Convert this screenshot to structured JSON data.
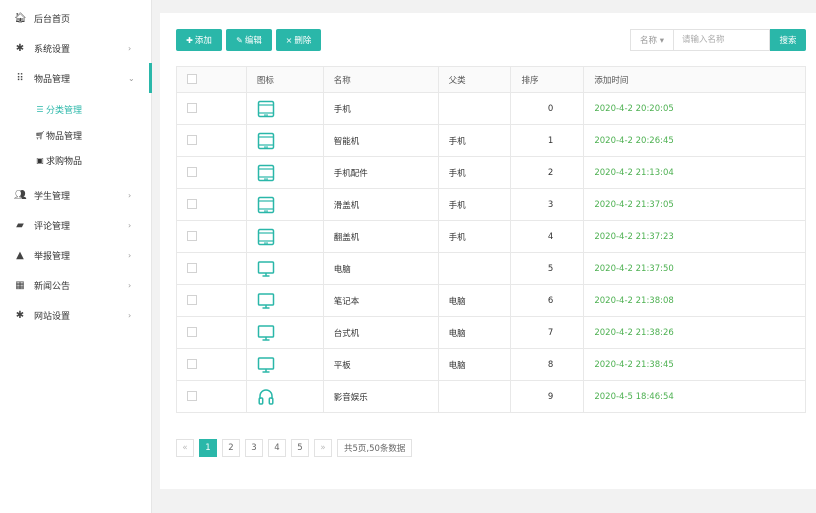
{
  "sidebar": {
    "items": [
      {
        "label": "后台首页",
        "icon": "home-icon",
        "glyph": "🏠︎"
      },
      {
        "label": "系统设置",
        "icon": "gear-icon",
        "glyph": "✱",
        "chevron": "›"
      },
      {
        "label": "物品管理",
        "icon": "grid-dots-icon",
        "glyph": "⠿",
        "chevron": "⌄"
      },
      {
        "label": "学生管理",
        "icon": "users-icon",
        "glyph": "👥︎",
        "chevron": "›"
      },
      {
        "label": "评论管理",
        "icon": "comment-icon",
        "glyph": "▰",
        "chevron": "›"
      },
      {
        "label": "举报管理",
        "icon": "warning-icon",
        "glyph": "▲",
        "chevron": "›"
      },
      {
        "label": "新闻公告",
        "icon": "news-icon",
        "glyph": "▦",
        "chevron": "›"
      },
      {
        "label": "网站设置",
        "icon": "gear-icon",
        "glyph": "✱",
        "chevron": "›"
      }
    ],
    "subitems": [
      {
        "label": "分类管理",
        "icon": "list-icon",
        "glyph": "☰"
      },
      {
        "label": "物品管理",
        "icon": "cart-icon",
        "glyph": "🛒︎"
      },
      {
        "label": "求购物品",
        "icon": "box-icon",
        "glyph": "▣"
      }
    ]
  },
  "toolbar": {
    "add_label": "添加",
    "add_glyph": "✚",
    "edit_label": "编辑",
    "edit_glyph": "✎",
    "delete_label": "删除",
    "delete_glyph": "×"
  },
  "search": {
    "field_label": "名称 ▾",
    "placeholder": "请输入名称",
    "button_label": "搜索"
  },
  "table": {
    "headers": [
      "图标",
      "名称",
      "父类",
      "排序",
      "添加时间"
    ],
    "rows": [
      {
        "icon": "phone",
        "name": "手机",
        "parent": "",
        "order": "0",
        "time": "2020-4-2 20:20:05"
      },
      {
        "icon": "phone",
        "name": "智能机",
        "parent": "手机",
        "order": "1",
        "time": "2020-4-2 20:26:45"
      },
      {
        "icon": "phone",
        "name": "手机配件",
        "parent": "手机",
        "order": "2",
        "time": "2020-4-2 21:13:04"
      },
      {
        "icon": "phone",
        "name": "滑盖机",
        "parent": "手机",
        "order": "3",
        "time": "2020-4-2 21:37:05"
      },
      {
        "icon": "phone",
        "name": "翻盖机",
        "parent": "手机",
        "order": "4",
        "time": "2020-4-2 21:37:23"
      },
      {
        "icon": "monitor",
        "name": "电脑",
        "parent": "",
        "order": "5",
        "time": "2020-4-2 21:37:50"
      },
      {
        "icon": "monitor",
        "name": "笔记本",
        "parent": "电脑",
        "order": "6",
        "time": "2020-4-2 21:38:08"
      },
      {
        "icon": "monitor",
        "name": "台式机",
        "parent": "电脑",
        "order": "7",
        "time": "2020-4-2 21:38:26"
      },
      {
        "icon": "monitor",
        "name": "平板",
        "parent": "电脑",
        "order": "8",
        "time": "2020-4-2 21:38:45"
      },
      {
        "icon": "headphones",
        "name": "影音娱乐",
        "parent": "",
        "order": "9",
        "time": "2020-4-5 18:46:54"
      }
    ]
  },
  "pagination": {
    "prev": "«",
    "pages": [
      "1",
      "2",
      "3",
      "4",
      "5"
    ],
    "current": "1",
    "next": "»",
    "info": "共5页,50条数据"
  },
  "colors": {
    "accent": "#2ab7a9",
    "time_text": "#4cb050"
  }
}
